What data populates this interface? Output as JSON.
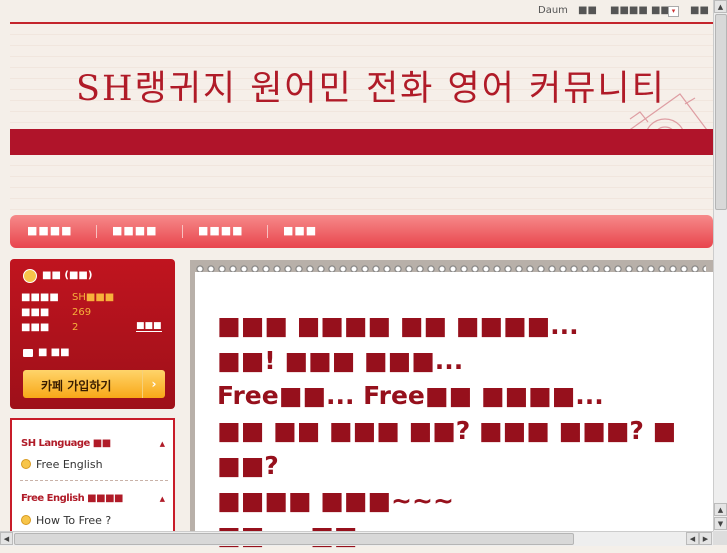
{
  "topbar": {
    "daum": "Daum",
    "item1": "■■",
    "item2": "■■■■ ■■",
    "item3": "■■"
  },
  "header": {
    "title": "SH랭귀지 원어민 전화 영어 커뮤니티"
  },
  "menu": {
    "items": [
      "■■■■",
      "■■■■",
      "■■■■",
      "■■■"
    ]
  },
  "profile": {
    "name": "■■ (■■)",
    "rows": [
      {
        "label": "■■■■",
        "value": "SH■■■"
      },
      {
        "label": "■■■",
        "value": "269"
      },
      {
        "label": "■■■",
        "value": "2"
      }
    ],
    "more": "■■■",
    "message": "■ ■■",
    "join_button": "카페 가입하기"
  },
  "sidemenu": {
    "groups": [
      {
        "title": "SH Language ■■",
        "item": "Free English"
      },
      {
        "title": "Free English ■■■■",
        "item": "How To Free ?"
      }
    ]
  },
  "post": {
    "lines": [
      "■■■ ■■■■ ■■ ■■■■...",
      "■■! ■■■ ■■■...",
      "Free■■... Free■■ ■■■■...",
      "■■ ■■ ■■■ ■■? ■■■ ■■■? ■",
      "■■?",
      "■■■■ ■■■~~~",
      "■■ ... ■■"
    ]
  },
  "colors": {
    "accent": "#b01b28",
    "menu": "#e8454d",
    "join": "#f8a818"
  }
}
